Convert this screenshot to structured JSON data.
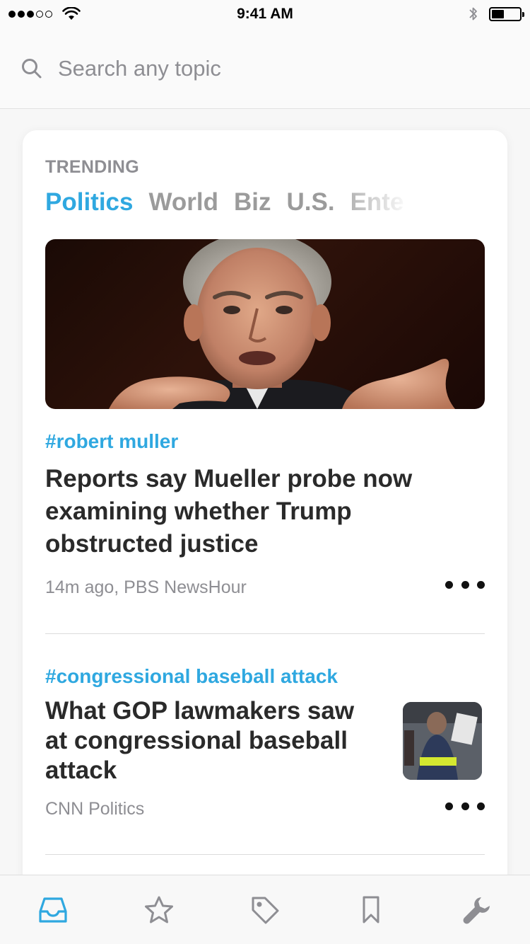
{
  "status_bar": {
    "time": "9:41 AM",
    "signal_total": 5,
    "signal_filled": 3,
    "battery_level": 0.45
  },
  "search": {
    "placeholder": "Search any topic",
    "value": ""
  },
  "trending": {
    "label": "TRENDING",
    "tabs": [
      "Politics",
      "World",
      "Biz",
      "U.S.",
      "Ente"
    ],
    "active_tab": "Politics"
  },
  "articles": [
    {
      "hashtag": "#robert muller",
      "headline": "Reports say Mueller probe now examining whether Trump obstructed justice",
      "meta": "14m ago, PBS NewsHour",
      "image": "hero-photo"
    },
    {
      "hashtag": "#congressional baseball attack",
      "headline": "What GOP lawmakers saw at congressional baseball attack",
      "meta": "CNN Politics",
      "image": "thumbnail-photo"
    }
  ],
  "tab_bar": {
    "items": [
      "inbox-icon",
      "star-icon",
      "tag-icon",
      "bookmark-icon",
      "wrench-icon"
    ],
    "active": "inbox-icon"
  },
  "colors": {
    "accent": "#2fa8e0",
    "text_primary": "#2a2a2a",
    "text_secondary": "#8e8e93",
    "icon_inactive": "#8e8e93"
  }
}
